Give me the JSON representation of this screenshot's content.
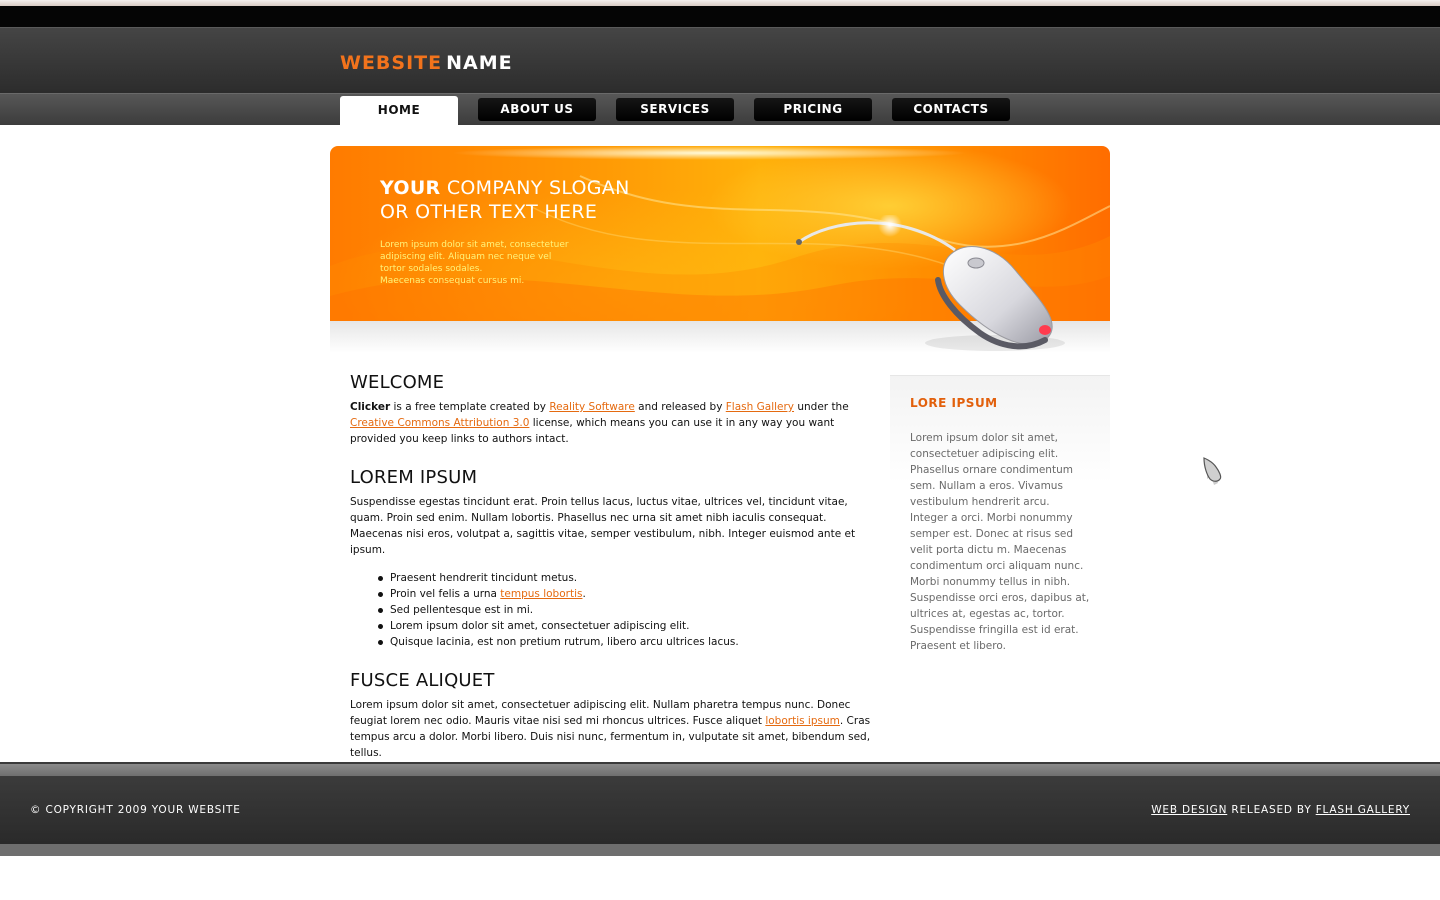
{
  "header": {
    "logo_part1": "WEBSITE",
    "logo_part2": "NAME"
  },
  "nav": {
    "items": [
      "HOME",
      "ABOUT US",
      "SERVICES",
      "PRICING",
      "CONTACTS"
    ],
    "active": "HOME"
  },
  "banner": {
    "slogan_bold": "YOUR",
    "slogan_rest": " COMPANY SLOGAN",
    "slogan_line2": "OR OTHER TEXT HERE",
    "text_lines": [
      "Lorem ipsum dolor sit amet, consectetuer",
      "adipiscing elit. Aliquam nec neque vel",
      "tortor sodales sodales.",
      "Maecenas consequat cursus mi."
    ]
  },
  "main": {
    "welcome": {
      "title": "WELCOME",
      "brand": "Clicker",
      "t1": " is a free template created by ",
      "link1": "Reality Software",
      "t2": " and released by ",
      "link2": "Flash Gallery",
      "t3": " under the ",
      "link3": "Creative Commons Attribution 3.0",
      "t4": " license, which means you can use it in any way you want provided you keep links to authors intact."
    },
    "lorem": {
      "title": "LOREM IPSUM",
      "text": "Suspendisse egestas tincidunt erat. Proin tellus lacus, luctus vitae, ultrices vel, tincidunt vitae, quam. Proin sed enim. Nullam lobortis. Phasellus nec urna sit amet nibh iaculis consequat. Maecenas nisi eros, volutpat a, sagittis vitae, semper vestibulum, nibh. Integer euismod ante et ipsum.",
      "list": [
        "Praesent hendrerit tincidunt metus.",
        "Proin vel felis a urna ",
        "Sed pellentesque est in mi.",
        "Lorem ipsum dolor sit amet, consectetuer adipiscing elit.",
        "Quisque lacinia, est non pretium rutrum, libero arcu ultrices lacus."
      ],
      "list_link": "tempus lobortis",
      "list_link_after": "."
    },
    "fusce": {
      "title": "FUSCE ALIQUET",
      "t1": "Lorem ipsum dolor sit amet, consectetuer adipiscing elit. Nullam pharetra tempus nunc. Donec feugiat lorem nec odio. Mauris vitae nisi sed mi rhoncus ultrices. Fusce aliquet ",
      "link": "lobortis ipsum",
      "t2": ". Cras tempus arcu a dolor. Morbi libero. Duis nisi nunc, fermentum in, vulputate sit amet, bibendum sed, tellus."
    }
  },
  "sidebar": {
    "title": "LORE IPSUM",
    "text": "Lorem ipsum dolor sit amet, consectetuer adipiscing elit. Phasellus ornare condimentum sem. Nullam a eros. Vivamus vestibulum hendrerit arcu. Integer a orci. Morbi nonummy semper est. Donec at risus sed velit porta dictu m. Maecenas condimentum orci aliquam nunc. Morbi nonummy tellus in nibh. Suspendisse orci eros, dapibus at, ultrices at, egestas ac, tortor. Suspendisse fringilla est id erat. Praesent et libero."
  },
  "footer": {
    "copyright": "© COPYRIGHT 2009 YOUR WEBSITE",
    "credit_link1": "WEB DESIGN",
    "credit_mid": " RELEASED BY ",
    "credit_link2": "FLASH GALLERY"
  },
  "colors": {
    "accent": "#f2731c",
    "banner": "#ff8a00",
    "link": "#e56a10"
  },
  "icons": {
    "cursor": "mouse-pointer-icon",
    "banner_image": "computer-mouse-icon"
  }
}
